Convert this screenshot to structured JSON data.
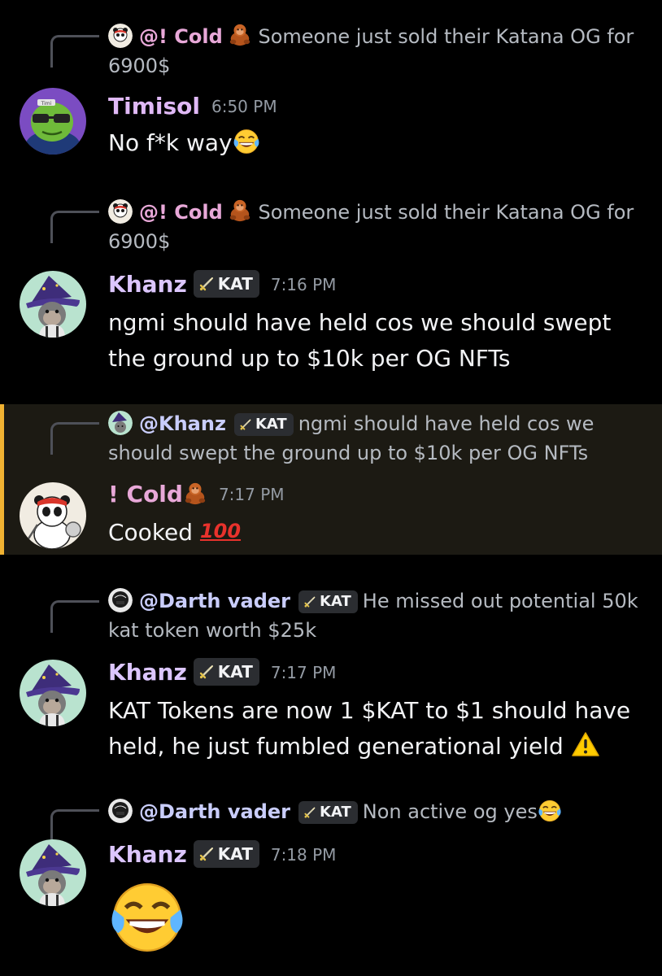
{
  "colors": {
    "background": "#000000",
    "highlight_bg": "#1c1a13",
    "highlight_bar": "#f0b232",
    "name_timisol": "#e0b9f6",
    "name_cold": "#e8a8d8",
    "name_khanz": "#dcc6ff",
    "name_mention": "#c9cdfb",
    "timestamp": "#949ba4"
  },
  "messages": [
    {
      "reply_name": "@!   Cold",
      "reply_text": "Someone just sold their Katana OG for 6900$",
      "author": "Timisol",
      "time": "6:50 PM",
      "text": "No f*k way",
      "avatar_icon": "green-frog-avatar"
    },
    {
      "reply_name": "@!   Cold",
      "reply_text": "Someone just sold their Katana OG for 6900$",
      "author": "Khanz",
      "tag": "KAT",
      "time": "7:16 PM",
      "text": "ngmi should have held cos we should swept the ground up to $10k per OG NFTs",
      "avatar_icon": "wizard-ape-avatar"
    },
    {
      "reply_name": "@Khanz",
      "reply_tag": "KAT",
      "reply_text": "ngmi should have held cos we should swept the ground up to $10k per OG NFTs",
      "author": "!   Cold",
      "time": "7:17 PM",
      "text": "Cooked",
      "avatar_icon": "panda-warrior-avatar"
    },
    {
      "reply_name": "@Darth vader",
      "reply_tag": "KAT",
      "reply_text": "He missed out potential 50k kat token worth $25k",
      "author": "Khanz",
      "tag": "KAT",
      "time": "7:17 PM",
      "text": "KAT Tokens are now 1 $KAT to $1 should have held, he just fumbled generational yield",
      "avatar_icon": "wizard-ape-avatar"
    },
    {
      "reply_name": "@Darth vader",
      "reply_tag": "KAT",
      "reply_text": "Non active og yes",
      "author": "Khanz",
      "tag": "KAT",
      "time": "7:18 PM",
      "text": "",
      "avatar_icon": "wizard-ape-avatar"
    }
  ]
}
